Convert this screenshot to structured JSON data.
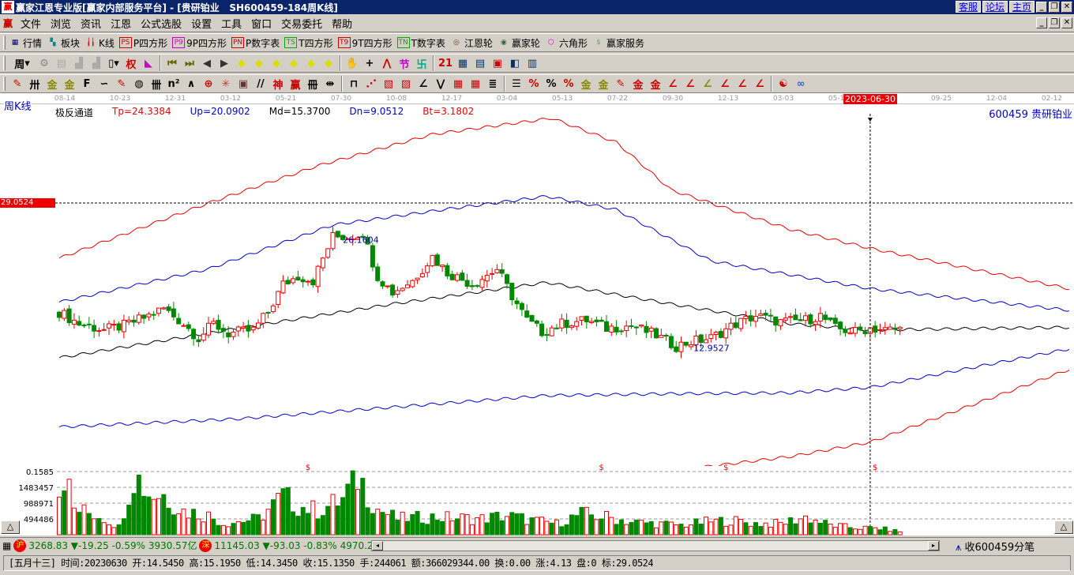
{
  "window": {
    "title": "赢家江恩专业版[赢家内部服务平台] - [贵研铂业   SH600459-184周K线]",
    "links": [
      "客服",
      "论坛",
      "主页"
    ],
    "controls": [
      "_",
      "❐",
      "✕"
    ]
  },
  "menu": {
    "logo": "赢",
    "items": [
      "文件",
      "浏览",
      "资讯",
      "江恩",
      "公式选股",
      "设置",
      "工具",
      "窗口",
      "交易委托",
      "帮助"
    ]
  },
  "toolbar1": [
    {
      "icon": "table-icon",
      "glyph": "▦",
      "label": "行情",
      "color": "#006"
    },
    {
      "icon": "blocks-icon",
      "glyph": "▚",
      "label": "板块",
      "color": "#088"
    },
    {
      "icon": "candles-icon",
      "glyph": "╽╽",
      "label": "K线",
      "color": "#c00"
    },
    {
      "icon": "ps-icon",
      "glyph": "PS",
      "label": "P四方形",
      "color": "#c00"
    },
    {
      "icon": "p9-icon",
      "glyph": "P9",
      "label": "9P四方形",
      "color": "#c0c"
    },
    {
      "icon": "pn-icon",
      "glyph": "PN",
      "label": "P数字表",
      "color": "#c00"
    },
    {
      "icon": "ts-icon",
      "glyph": "TS",
      "label": "T四方形",
      "color": "#0a0"
    },
    {
      "icon": "t9-icon",
      "glyph": "T9",
      "label": "9T四方形",
      "color": "#c00"
    },
    {
      "icon": "tn-icon",
      "glyph": "TN",
      "label": "T数字表",
      "color": "#0a0"
    },
    {
      "icon": "gann-wheel-icon",
      "glyph": "◎",
      "label": "江恩轮",
      "color": "#633"
    },
    {
      "icon": "winner-wheel-icon",
      "glyph": "◉",
      "label": "赢家轮",
      "color": "#363"
    },
    {
      "icon": "hexagon-icon",
      "glyph": "⬡",
      "label": "六角形",
      "color": "#c0c"
    },
    {
      "icon": "dollar-icon",
      "glyph": "$",
      "label": "赢家服务",
      "color": "#6a6"
    }
  ],
  "toolbar2": {
    "period": "周",
    "icons": [
      [
        "settings-icon",
        "⚙",
        "#888"
      ],
      [
        "doc-icon",
        "▤",
        "#aaa"
      ],
      [
        "bars3-icon",
        "▟",
        "#aaa"
      ],
      [
        "bars9-icon",
        "▟",
        "#aaa"
      ],
      [
        "candle-type-icon",
        "▯▾",
        "#000"
      ],
      [
        "weight-icon",
        "权",
        "#c00"
      ],
      [
        "flag-icon",
        "◣",
        "#c0c"
      ],
      [
        "|"
      ],
      [
        "first-icon",
        "⏮",
        "#660"
      ],
      [
        "last-icon",
        "⏭",
        "#660"
      ],
      [
        "prev-icon",
        "◀",
        "#333"
      ],
      [
        "next-icon",
        "▶",
        "#333"
      ],
      [
        "nav-left-icon",
        "◆",
        "#dd0"
      ],
      [
        "nav-right-icon",
        "◆",
        "#dd0"
      ],
      [
        "nav-lr-icon",
        "◆",
        "#dd0"
      ],
      [
        "nav-cross-icon",
        "◆",
        "#dd0"
      ],
      [
        "nav-star-icon",
        "◆",
        "#dd0"
      ],
      [
        "nav-ud-icon",
        "◆",
        "#dd0"
      ],
      [
        "|"
      ],
      [
        "hand-icon",
        "✋",
        "#000"
      ],
      [
        "crosshair-icon",
        "+",
        "#000"
      ],
      [
        "zigzag-icon",
        "⋀",
        "#c00"
      ],
      [
        "pattern-icon",
        "节",
        "#c0c"
      ],
      [
        "spiral-icon",
        "卐",
        "#0a8"
      ],
      [
        "|"
      ],
      [
        "calendar-icon",
        "21",
        "#c00"
      ],
      [
        "calculator-icon",
        "▦",
        "#036"
      ],
      [
        "report-icon",
        "▤",
        "#036"
      ],
      [
        "save-icon",
        "▣",
        "#c00"
      ],
      [
        "network-icon",
        "◧",
        "#036"
      ],
      [
        "print-icon",
        "▥",
        "#036"
      ]
    ]
  },
  "toolbar3": {
    "icons": [
      [
        "pen-icon",
        "✎",
        "#c00"
      ],
      [
        "grid-icon",
        "卅",
        "#000"
      ],
      [
        "gold1-icon",
        "金",
        "#880"
      ],
      [
        "gold2-icon",
        "金",
        "#880"
      ],
      [
        "f-icon",
        "F",
        "#000"
      ],
      [
        "spring-icon",
        "∽",
        "#000"
      ],
      [
        "ruler-pen-icon",
        "✎",
        "#c00"
      ],
      [
        "circle-scale-icon",
        "◍",
        "#000"
      ],
      [
        "hash-icon",
        "卌",
        "#000"
      ],
      [
        "n2-icon",
        "n²",
        "#000"
      ],
      [
        "arrow-fan-icon",
        "∧",
        "#000"
      ],
      [
        "target-icon",
        "⊕",
        "#c00"
      ],
      [
        "burst-icon",
        "✳",
        "#c33"
      ],
      [
        "square-web-icon",
        "▣",
        "#633"
      ],
      [
        "lines-icon",
        "//",
        "#000"
      ],
      [
        "shen-icon",
        "神",
        "#c00"
      ],
      [
        "ying-icon",
        "赢",
        "#c00"
      ],
      [
        "comb-icon",
        "冊",
        "#000"
      ],
      [
        "width-icon",
        "⇹",
        "#000"
      ],
      [
        "|"
      ],
      [
        "box-icon",
        "⊓",
        "#000"
      ],
      [
        "fan-icon",
        "⋰",
        "#c00"
      ],
      [
        "gann-box-icon",
        "▧",
        "#c00"
      ],
      [
        "gann-square-icon",
        "▨",
        "#c00"
      ],
      [
        "angle-icon",
        "∠",
        "#000"
      ],
      [
        "wave-icon",
        "⋁",
        "#000"
      ],
      [
        "grid-red-icon",
        "▦",
        "#c00"
      ],
      [
        "grid2-icon",
        "▦",
        "#c00"
      ],
      [
        "parallel-icon",
        "≣",
        "#000"
      ],
      [
        "|"
      ],
      [
        "ladder-icon",
        "☰",
        "#000"
      ],
      [
        "pct-red-icon",
        "%",
        "#c00"
      ],
      [
        "pct-icon",
        "%",
        "#000"
      ],
      [
        "pct-lines-icon",
        "%",
        "#c00"
      ],
      [
        "gold-coin-icon",
        "金",
        "#880"
      ],
      [
        "gold-lines-icon",
        "金",
        "#880"
      ],
      [
        "ruler-drop-icon",
        "✎",
        "#c00"
      ],
      [
        "gold-arc-icon",
        "金",
        "#c00"
      ],
      [
        "gold-box-icon",
        "金",
        "#c00"
      ],
      [
        "j-angle-icon",
        "∠",
        "#c00"
      ],
      [
        "f-angle-icon",
        "∠",
        "#c00"
      ],
      [
        "gold-angle-icon",
        "∠",
        "#880"
      ],
      [
        "shen-angle-icon",
        "∠",
        "#c00"
      ],
      [
        "ying-angle-icon",
        "∠",
        "#c00"
      ],
      [
        "four-angle-icon",
        "∠",
        "#c00"
      ],
      [
        "|"
      ],
      [
        "yinyang-icon",
        "☯",
        "#c00"
      ],
      [
        "infinity-icon",
        "∞",
        "#36c"
      ]
    ]
  },
  "axis": {
    "period_label": "周K线",
    "dates": [
      "08-14",
      "10-23",
      "12-31",
      "03-12",
      "05-21",
      "07-30",
      "10-08",
      "12-17",
      "03-04",
      "05-13",
      "07-22",
      "09-30",
      "12-13",
      "03-03",
      "05-12",
      "2023-06-30",
      "09-25",
      "12-04",
      "02-12"
    ],
    "selected_date": "2023-06-30"
  },
  "indicator": {
    "name": "极反通道",
    "tp": "Tp=24.3384",
    "up": "Up=20.0902",
    "md": "Md=15.3700",
    "dn": "Dn=9.0512",
    "bt": "Bt=3.1802",
    "colors": {
      "tp": "#e00",
      "up": "#00c",
      "md": "#000",
      "dn": "#00c",
      "bt": "#e00"
    }
  },
  "stock": "600459 贵研铂业",
  "crosshair_price": "29.0524",
  "chart_data": {
    "type": "candlestick",
    "title": "贵研铂业 SH600459 周K线",
    "candle_count": 172,
    "selected_index": 163,
    "price_range": [
      -5,
      42
    ],
    "high_label": "26.1604",
    "low_label": "12.9527",
    "price_path": [
      [
        0,
        16.9
      ],
      [
        4,
        15.6
      ],
      [
        9,
        14.9
      ],
      [
        13,
        15.4
      ],
      [
        18,
        16.5
      ],
      [
        21,
        17.3
      ],
      [
        25,
        15.6
      ],
      [
        28,
        14.0
      ],
      [
        31,
        15.6
      ],
      [
        34,
        14.5
      ],
      [
        39,
        14.9
      ],
      [
        42,
        16.9
      ],
      [
        45,
        20.0
      ],
      [
        48,
        20.9
      ],
      [
        51,
        20.4
      ],
      [
        55,
        25.3
      ],
      [
        58,
        25.3
      ],
      [
        61,
        25.7
      ],
      [
        64,
        20.9
      ],
      [
        67,
        19.1
      ],
      [
        71,
        20.4
      ],
      [
        75,
        23.1
      ],
      [
        78,
        21.3
      ],
      [
        83,
        20.0
      ],
      [
        88,
        21.7
      ],
      [
        91,
        18.7
      ],
      [
        94,
        16.0
      ],
      [
        97,
        14.7
      ],
      [
        101,
        15.6
      ],
      [
        106,
        16.0
      ],
      [
        110,
        15.1
      ],
      [
        115,
        15.4
      ],
      [
        120,
        14.3
      ],
      [
        124,
        13.1
      ],
      [
        127,
        13.6
      ],
      [
        131,
        14.0
      ],
      [
        136,
        15.6
      ],
      [
        140,
        16.5
      ],
      [
        145,
        15.8
      ],
      [
        150,
        16.0
      ],
      [
        153,
        16.5
      ],
      [
        156,
        15.1
      ],
      [
        160,
        14.7
      ],
      [
        163,
        15.135
      ],
      [
        166,
        14.9
      ],
      [
        169,
        15.0
      ]
    ],
    "channels": [
      {
        "name": "Tp",
        "color": "#e00",
        "points": [
          [
            0,
            22.9
          ],
          [
            30,
            29.05
          ],
          [
            52,
            33.2
          ],
          [
            75,
            36.7
          ],
          [
            99,
            38.5
          ],
          [
            112,
            35.8
          ],
          [
            123,
            30.5
          ],
          [
            147,
            26.1
          ],
          [
            163,
            24.0
          ],
          [
            203,
            19.5
          ]
        ]
      },
      {
        "name": "Up",
        "color": "#00c",
        "points": [
          [
            0,
            18.0
          ],
          [
            30,
            21.7
          ],
          [
            55,
            26.6
          ],
          [
            77,
            28.3
          ],
          [
            98,
            29.8
          ],
          [
            112,
            28.3
          ],
          [
            131,
            22.6
          ],
          [
            163,
            19.5
          ],
          [
            203,
            17.1
          ]
        ]
      },
      {
        "name": "Md",
        "color": "#000",
        "points": [
          [
            0,
            11.8
          ],
          [
            36,
            15.1
          ],
          [
            67,
            17.8
          ],
          [
            98,
            20.2
          ],
          [
            123,
            17.8
          ],
          [
            147,
            15.6
          ],
          [
            163,
            14.9
          ],
          [
            203,
            15.2
          ]
        ]
      },
      {
        "name": "Dn",
        "color": "#00c",
        "points": [
          [
            0,
            4.1
          ],
          [
            36,
            5.0
          ],
          [
            67,
            6.3
          ],
          [
            98,
            7.6
          ],
          [
            123,
            7.8
          ],
          [
            147,
            7.9
          ],
          [
            163,
            8.5
          ],
          [
            203,
            12.8
          ]
        ]
      },
      {
        "name": "Bt",
        "color": "#e00",
        "points": [
          [
            117,
            -1.2
          ],
          [
            147,
            0.8
          ],
          [
            163,
            2.4
          ],
          [
            203,
            10.5
          ]
        ]
      }
    ],
    "volume": {
      "ticks": [
        "0.1585",
        "1483457",
        "988971",
        "494486"
      ],
      "tick_values": [
        1978000,
        1483457,
        988971,
        494486
      ],
      "dividend_marks": [
        "$",
        "$",
        "$",
        "$"
      ],
      "dividend_indexes": [
        50,
        109,
        134,
        164
      ],
      "path": [
        [
          0,
          1400000
        ],
        [
          1,
          1980000
        ],
        [
          3,
          800000
        ],
        [
          8,
          600000
        ],
        [
          12,
          250000
        ],
        [
          15,
          1950000
        ],
        [
          18,
          1300000
        ],
        [
          21,
          1250000
        ],
        [
          25,
          750000
        ],
        [
          30,
          600000
        ],
        [
          33,
          350000
        ],
        [
          40,
          500000
        ],
        [
          45,
          1200000
        ],
        [
          48,
          900000
        ],
        [
          52,
          750000
        ],
        [
          57,
          1100000
        ],
        [
          60,
          1850000
        ],
        [
          64,
          800000
        ],
        [
          68,
          500000
        ],
        [
          75,
          550000
        ],
        [
          85,
          500000
        ],
        [
          90,
          600000
        ],
        [
          95,
          450000
        ],
        [
          100,
          350000
        ],
        [
          105,
          650000
        ],
        [
          110,
          550000
        ],
        [
          115,
          400000
        ],
        [
          120,
          350000
        ],
        [
          125,
          300000
        ],
        [
          130,
          400000
        ],
        [
          135,
          450000
        ],
        [
          140,
          350000
        ],
        [
          145,
          350000
        ],
        [
          150,
          550000
        ],
        [
          155,
          300000
        ],
        [
          160,
          220000
        ],
        [
          165,
          200000
        ],
        [
          169,
          100000
        ]
      ]
    }
  },
  "status": {
    "sh_badge": "沪",
    "sh_index": "3268.83",
    "sh_change": "▼-19.25",
    "sh_pct": "-0.59%",
    "sh_amount": "3930.57亿",
    "sz_badge": "深",
    "sz_index": "11145.03",
    "sz_change": "▼-93.03",
    "sz_pct": "-0.83%",
    "sz_amount": "4970.2",
    "receiving": "收600459分笔"
  },
  "info": "[五月十三] 时间:20230630 开:14.5450 高:15.1950 低:14.3450 收:15.1350 手:244061 额:366029344.00 换:0.00 涨:4.13 盘:0 标:29.0524"
}
